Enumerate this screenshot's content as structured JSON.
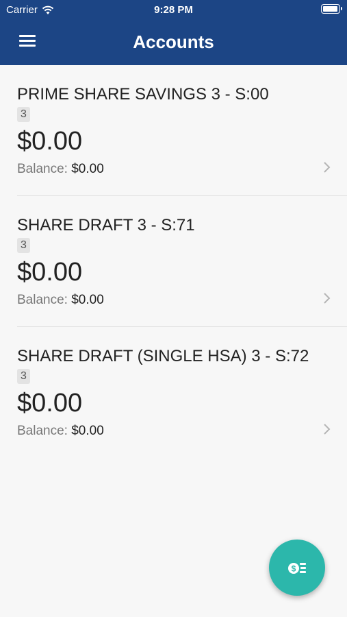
{
  "status_bar": {
    "carrier": "Carrier",
    "time": "9:28 PM",
    "battery_level": 1.0
  },
  "nav": {
    "title": "Accounts",
    "menu_icon": "menu-icon"
  },
  "accounts": [
    {
      "name": "PRIME SHARE SAVINGS 3 - S:00",
      "suffix": "3",
      "amount": "$0.00",
      "balance_label": "Balance:",
      "balance": "$0.00"
    },
    {
      "name": "SHARE DRAFT 3 - S:71",
      "suffix": "3",
      "amount": "$0.00",
      "balance_label": "Balance:",
      "balance": "$0.00"
    },
    {
      "name": "SHARE DRAFT (SINGLE HSA) 3 - S:72",
      "suffix": "3",
      "amount": "$0.00",
      "balance_label": "Balance:",
      "balance": "$0.00"
    }
  ],
  "fab": {
    "icon": "transfer-money-icon"
  },
  "colors": {
    "header": "#1c4585",
    "fab": "#2cb7ab",
    "background": "#f7f7f7"
  }
}
